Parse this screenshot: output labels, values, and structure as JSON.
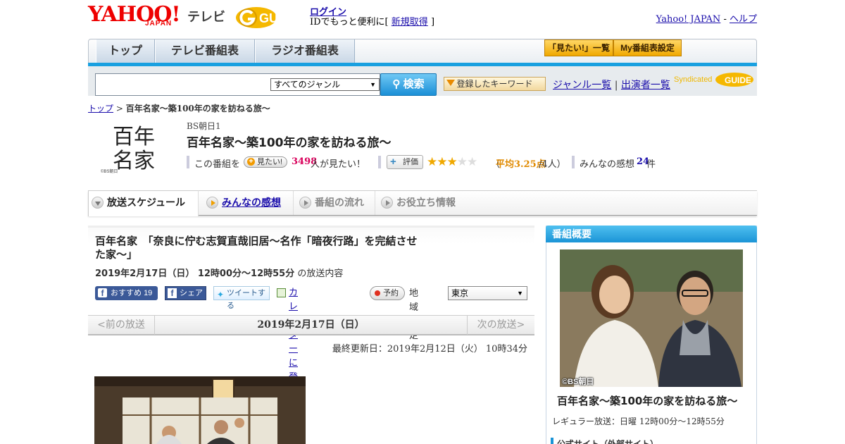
{
  "header": {
    "yahoo_logo": "YAHOO!",
    "japan_label": "JAPAN",
    "tv_label": "テレビ",
    "guide_logo": "GUIDE",
    "login_label": "ログイン",
    "login_sub_prefix": "IDでもっと便利に[",
    "signup_label": "新規取得",
    "login_sub_suffix": "]",
    "yahoo_japan_link": "Yahoo! JAPAN",
    "link_sep": "-",
    "help_link": "ヘルプ"
  },
  "nav": {
    "tabs": [
      {
        "label": "トップ"
      },
      {
        "label": "テレビ番組表"
      },
      {
        "label": "ラジオ番組表"
      }
    ],
    "mitai_list": "「見たい!」一覧",
    "my_bangumi": "My番組表設定"
  },
  "search": {
    "placeholder": "",
    "genre_selected": "すべてのジャンル",
    "button_label": "検索",
    "keyword_button": "登録したキーワード",
    "genre_list_link": "ジャンル一覧",
    "link_sep": "|",
    "performer_list_link": "出演者一覧",
    "syndicated": "Syndicated"
  },
  "breadcrumb": {
    "top": "トップ",
    "sep": ">",
    "current": "百年名家～築100年の家を訪ねる旅～"
  },
  "program": {
    "logo_text_1": "百年",
    "logo_text_2": "名家",
    "logo_copyright": "©BS朝日",
    "channel": "BS朝日1",
    "title": "百年名家～築100年の家を訪ねる旅～",
    "mitai_prefix": "この番組を",
    "mitai_button": "見たい!",
    "mitai_count": "3498",
    "mitai_suffix": "人が見たい！",
    "hyoka_button": "評価",
    "rating_stars": 3,
    "rating_max": 5,
    "rating_open": "（",
    "rating_text": "平均3.25点",
    "rating_users": "/4人）",
    "impressions_label": "みんなの感想",
    "impressions_count": "24",
    "impressions_unit": "件"
  },
  "tabs": [
    {
      "label": "放送スケジュール",
      "state": "active"
    },
    {
      "label": "みんなの感想",
      "state": "link"
    },
    {
      "label": "番組の流れ",
      "state": "disabled"
    },
    {
      "label": "お役立ち情報",
      "state": "disabled"
    }
  ],
  "episode": {
    "title": "百年名家　「奈良に佇む志賀直哉旧居～名作「暗夜行路」を完結させた家～」",
    "date_bold": "2019年2月17日（日） 12時00分～12時55分",
    "date_suffix": "の放送内容",
    "fb_osusume": "おすすめ",
    "fb_count": "19",
    "fb_share": "シェア",
    "tweet": "ツイートする",
    "calendar": "カレンダーに登録",
    "yoyaku": "予約",
    "region_label": "地域設定",
    "region_selected": "東京",
    "prev": "<前の放送",
    "current_date": "2019年2月17日（日）",
    "next": "次の放送>",
    "updated": "最終更新日：2019年2月12日（火） 10時34分"
  },
  "sidebar": {
    "heading": "番組概要",
    "copyright": "©BS朝日",
    "title": "百年名家～築100年の家を訪ねる旅～",
    "regular": "レギュラー放送：日曜 12時00分～12時55分",
    "official": "公式サイト（外部サイト）"
  },
  "colors": {
    "accent_blue": "#19a0e0",
    "yahoo_red": "#ee0000",
    "star": "#f0a800",
    "count_red": "#d9005b"
  }
}
